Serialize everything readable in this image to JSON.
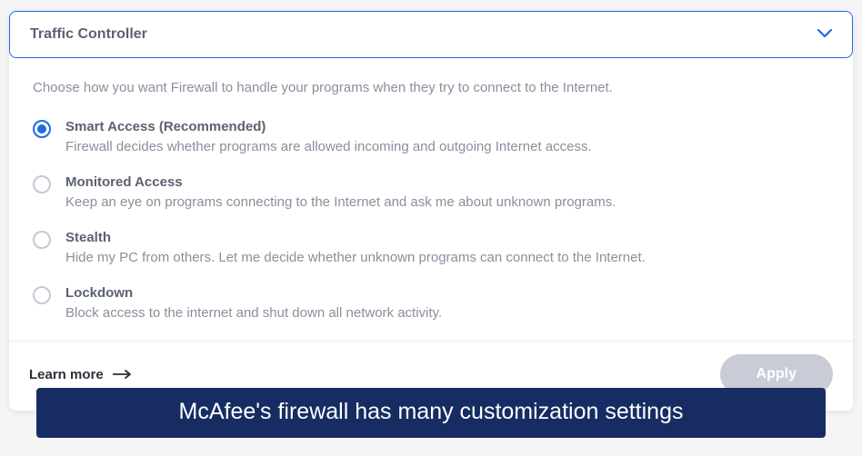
{
  "header": {
    "title": "Traffic Controller"
  },
  "description": "Choose how you want Firewall to handle your programs when they try to connect to the Internet.",
  "options": [
    {
      "title": "Smart Access (Recommended)",
      "desc": "Firewall decides whether programs are allowed incoming and outgoing Internet access.",
      "selected": true
    },
    {
      "title": "Monitored Access",
      "desc": "Keep an eye on programs connecting to the Internet and ask me about unknown programs.",
      "selected": false
    },
    {
      "title": "Stealth",
      "desc": "Hide my PC from others. Let me decide whether unknown programs can connect to the Internet.",
      "selected": false
    },
    {
      "title": "Lockdown",
      "desc": "Block access to the internet and shut down all network activity.",
      "selected": false
    }
  ],
  "footer": {
    "learn_more": "Learn more",
    "apply": "Apply"
  },
  "caption": "McAfee's firewall has many customization settings"
}
